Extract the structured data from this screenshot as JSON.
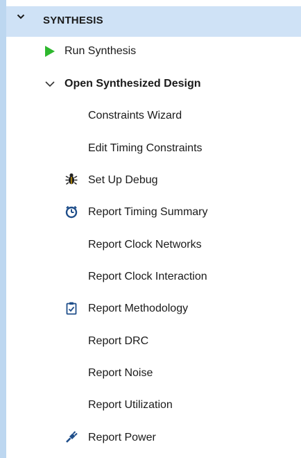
{
  "section": {
    "title": "SYNTHESIS",
    "chevron_icon": "chevron-down-icon"
  },
  "items": [
    {
      "label": "Run Synthesis",
      "icon": "run-play-icon",
      "color": "#2eb82e"
    },
    {
      "label": "Open Synthesized Design",
      "icon": "chevron-down-icon",
      "bold": true
    },
    {
      "label": "Constraints Wizard"
    },
    {
      "label": "Edit Timing Constraints"
    },
    {
      "label": "Set Up Debug",
      "icon": "debug-bug-icon"
    },
    {
      "label": "Report Timing Summary",
      "icon": "stopwatch-icon",
      "color": "#1f4e8a"
    },
    {
      "label": "Report Clock Networks"
    },
    {
      "label": "Report Clock Interaction"
    },
    {
      "label": "Report Methodology",
      "icon": "clipboard-check-icon",
      "color": "#1f4e8a"
    },
    {
      "label": "Report DRC"
    },
    {
      "label": "Report Noise"
    },
    {
      "label": "Report Utilization"
    },
    {
      "label": "Report Power",
      "icon": "power-plug-icon",
      "color": "#1f4e8a"
    }
  ],
  "colors": {
    "header_bg": "#cfe2f6",
    "left_strip": "#bdd7f0",
    "text": "#1a1a1a"
  }
}
